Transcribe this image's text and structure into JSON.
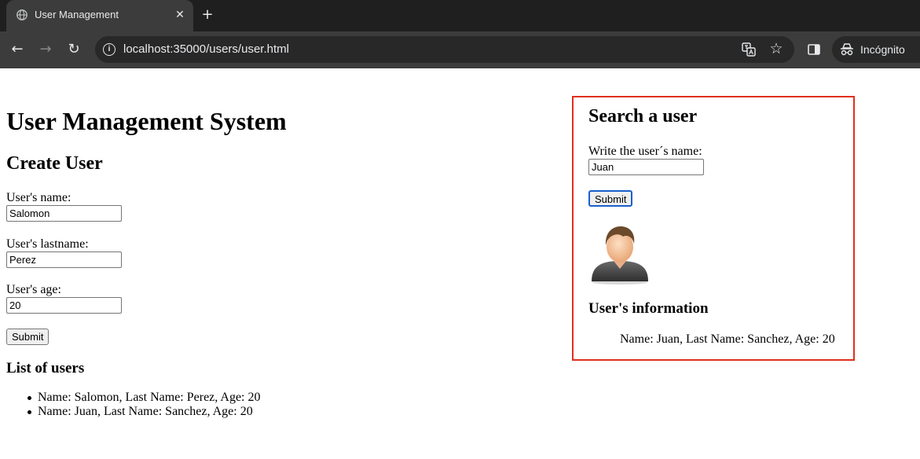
{
  "browser": {
    "tab_title": "User Management",
    "tab_close": "✕",
    "new_tab": "+",
    "url": "localhost:35000/users/user.html",
    "profile_label": "Incógnito"
  },
  "page": {
    "title": "User Management System",
    "create": {
      "heading": "Create User",
      "name_label": "User's name:",
      "name_value": "Salomon",
      "lastname_label": "User's lastname:",
      "lastname_value": "Perez",
      "age_label": "User's age:",
      "age_value": "20",
      "submit_label": "Submit"
    },
    "list": {
      "heading": "List of users",
      "items": [
        "Name: Salomon, Last Name: Perez, Age: 20",
        "Name: Juan, Last Name: Sanchez, Age: 20"
      ]
    },
    "search": {
      "heading": "Search a user",
      "label": "Write the user´s name:",
      "value": "Juan",
      "submit_label": "Submit",
      "info_heading": "User's information",
      "info_text": "Name: Juan, Last Name: Sanchez, Age: 20"
    }
  },
  "colors": {
    "search_border": "#e0301e",
    "focus_ring": "#1a5fcc",
    "chrome_dark": "#1f1f1f"
  }
}
